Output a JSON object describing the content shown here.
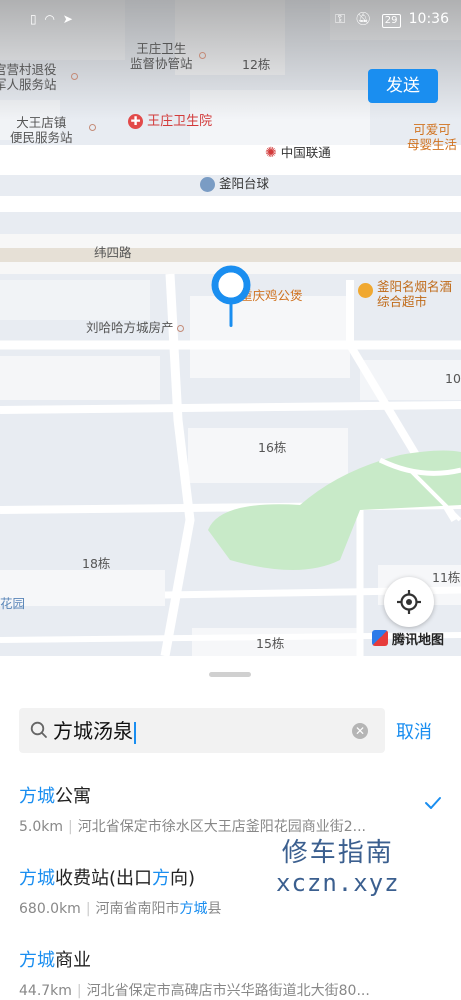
{
  "status_bar": {
    "time": "10:36",
    "battery": "29"
  },
  "map": {
    "send_label": "发送",
    "labels": {
      "wangzhuang_supervise": "王庄卫生\n监督协管站",
      "building_12": "12栋",
      "guanying_village": "宫营村退役\n军人服务站",
      "dawang_service": "大王店镇\n便民服务站",
      "wangzhuang_hospital": "王庄卫生院",
      "keai_baby": "可爱可\n母婴生活",
      "china_unicom": "中国联通",
      "fuyang_billiards": "釜阳台球",
      "weisi_road": "纬四路",
      "chongqing_chicken": "重庆鸡公煲",
      "fuyang_tobacco": "釜阳名烟名酒\n综合超市",
      "liuhaha_realty": "刘哈哈方城房产",
      "building_10": "10",
      "building_16": "16栋",
      "building_18": "18栋",
      "building_11": "11栋",
      "garden": "花园",
      "building_15": "15栋"
    },
    "provider": "腾讯地图",
    "colors": {
      "accent": "#1a8ef0",
      "pin": "#1a8ef0",
      "park": "#c8eac8"
    }
  },
  "search": {
    "query": "方城汤泉",
    "cancel_label": "取消"
  },
  "results": [
    {
      "name_hl": "方城",
      "name_rest": "公寓",
      "distance": "5.0km",
      "address": "河北省保定市徐水区大王店釜阳花园商业街2...",
      "selected": true
    },
    {
      "name_hl": "方城",
      "name_rest": "收费站(出口",
      "name_hl2": "方",
      "name_rest2": "向)",
      "distance": "680.0km",
      "address_pre": "河南省南阳市",
      "address_hl": "方城",
      "address_post": "县",
      "selected": false
    },
    {
      "name_hl": "方城",
      "name_rest": "商业",
      "distance": "44.7km",
      "address": "河北省保定市高碑店市兴华路街道北大街80...",
      "selected": false
    }
  ],
  "watermark": {
    "line1": "修车指南",
    "line2": "xczn.xyz"
  }
}
